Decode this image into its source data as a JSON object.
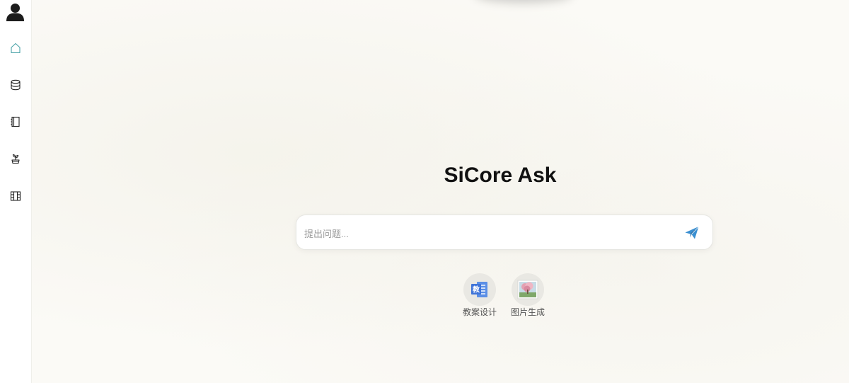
{
  "app": {
    "title": "SiCore Ask"
  },
  "sidebar": {
    "items": [
      {
        "name": "home",
        "icon": "home-icon"
      },
      {
        "name": "database",
        "icon": "database-icon"
      },
      {
        "name": "notebook",
        "icon": "notebook-icon"
      },
      {
        "name": "plant",
        "icon": "plant-icon"
      },
      {
        "name": "grid",
        "icon": "grid-icon"
      }
    ],
    "active_color": "#4aa3a8"
  },
  "search": {
    "placeholder": "提出问题...",
    "value": "",
    "send_icon": "paper-plane-icon",
    "send_color": "#3a8fd1"
  },
  "quick_actions": [
    {
      "label": "教案设计",
      "icon": "document-icon",
      "icon_text": "教"
    },
    {
      "label": "图片生成",
      "icon": "image-icon"
    }
  ]
}
